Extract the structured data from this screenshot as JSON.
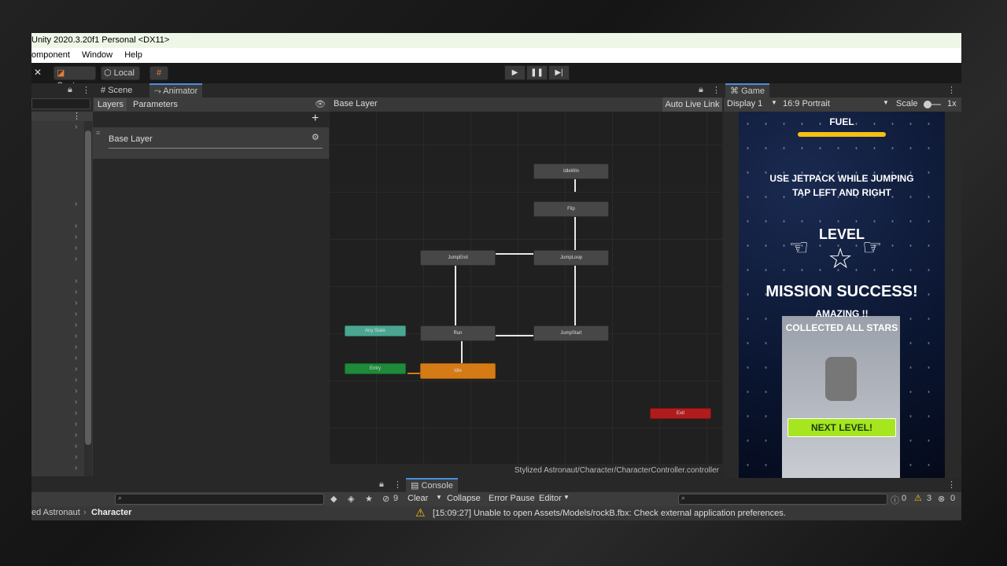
{
  "window": {
    "title": "Unity 2020.3.20f1 Personal <DX11>",
    "menu": [
      "omponent",
      "Window",
      "Help"
    ]
  },
  "toolbar": {
    "center_label": "Center",
    "local_label": "Local"
  },
  "tabs": {
    "scene": "Scene",
    "animator": "Animator",
    "game": "Game",
    "console": "Console"
  },
  "animator": {
    "layers_tab": "Layers",
    "parameters_tab": "Parameters",
    "layer_name": "Base Layer",
    "breadcrumb": "Base Layer",
    "auto_live_link": "Auto Live Link",
    "controller_path": "Stylized Astronaut/Character/CharacterController.controller",
    "states": {
      "idle_win": "IdleWin",
      "flip": "Flip",
      "jump_end": "JumpEnd",
      "jump_loop": "JumpLoop",
      "any_state": "Any State",
      "run": "Run",
      "jump_start": "JumpStart",
      "entry": "Entry",
      "idle": "Idle",
      "exit": "Exit"
    }
  },
  "game": {
    "display": "Display 1",
    "aspect": "16:9 Portrait",
    "scale_label": "Scale",
    "scale_value": "1x",
    "fuel_label": "FUEL",
    "fuel_level": 1.0,
    "instruction_line1": "USE JETPACK WHILE JUMPING",
    "instruction_line2": "TAP LEFT AND RIGHT",
    "level_label": "LEVEL",
    "mission_text": "MISSION SUCCESS!",
    "amazing": "AMAZING !!",
    "collected": "COLLECTED ALL STARS",
    "next_level": "NEXT LEVEL!"
  },
  "project": {
    "breadcrumb_parent": "ed Astronaut",
    "breadcrumb_current": "Character",
    "hidden_count": "9"
  },
  "console": {
    "clear": "Clear",
    "collapse": "Collapse",
    "error_pause": "Error Pause",
    "editor": "Editor",
    "info_count": "0",
    "warning_count": "3",
    "error_count": "0",
    "message": "[15:09:27] Unable to open Assets/Models/rockB.fbx: Check external application preferences."
  },
  "colors": {
    "accent": "#4a8de0",
    "idle_state": "#d47b16",
    "any_state": "#4aa690",
    "entry_state": "#1e8a3a",
    "exit_state": "#b01c1c",
    "next_level_button": "#a6e61e"
  }
}
